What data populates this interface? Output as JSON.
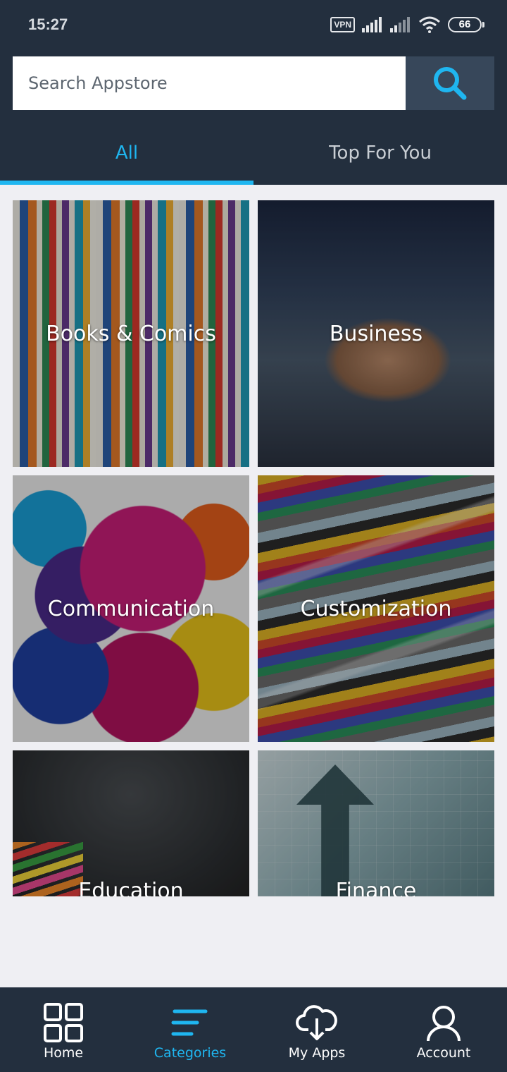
{
  "status_bar": {
    "time": "15:27",
    "vpn_label": "VPN",
    "battery_level": "66"
  },
  "search": {
    "placeholder": "Search Appstore"
  },
  "tabs": [
    {
      "label": "All",
      "selected": true
    },
    {
      "label": "Top For You",
      "selected": false
    }
  ],
  "categories": [
    {
      "label": "Books & Comics"
    },
    {
      "label": "Business"
    },
    {
      "label": "Communication"
    },
    {
      "label": "Customization"
    },
    {
      "label": "Education"
    },
    {
      "label": "Finance"
    }
  ],
  "bottom_nav": [
    {
      "label": "Home",
      "icon": "grid-icon",
      "active": false
    },
    {
      "label": "Categories",
      "icon": "menu-lines-icon",
      "active": true
    },
    {
      "label": "My Apps",
      "icon": "cloud-download-icon",
      "active": false
    },
    {
      "label": "Account",
      "icon": "person-icon",
      "active": false
    }
  ],
  "colors": {
    "header_bg": "#232f3e",
    "accent": "#1fb6f0",
    "search_button_bg": "#37475a",
    "page_bg": "#efeff3"
  }
}
